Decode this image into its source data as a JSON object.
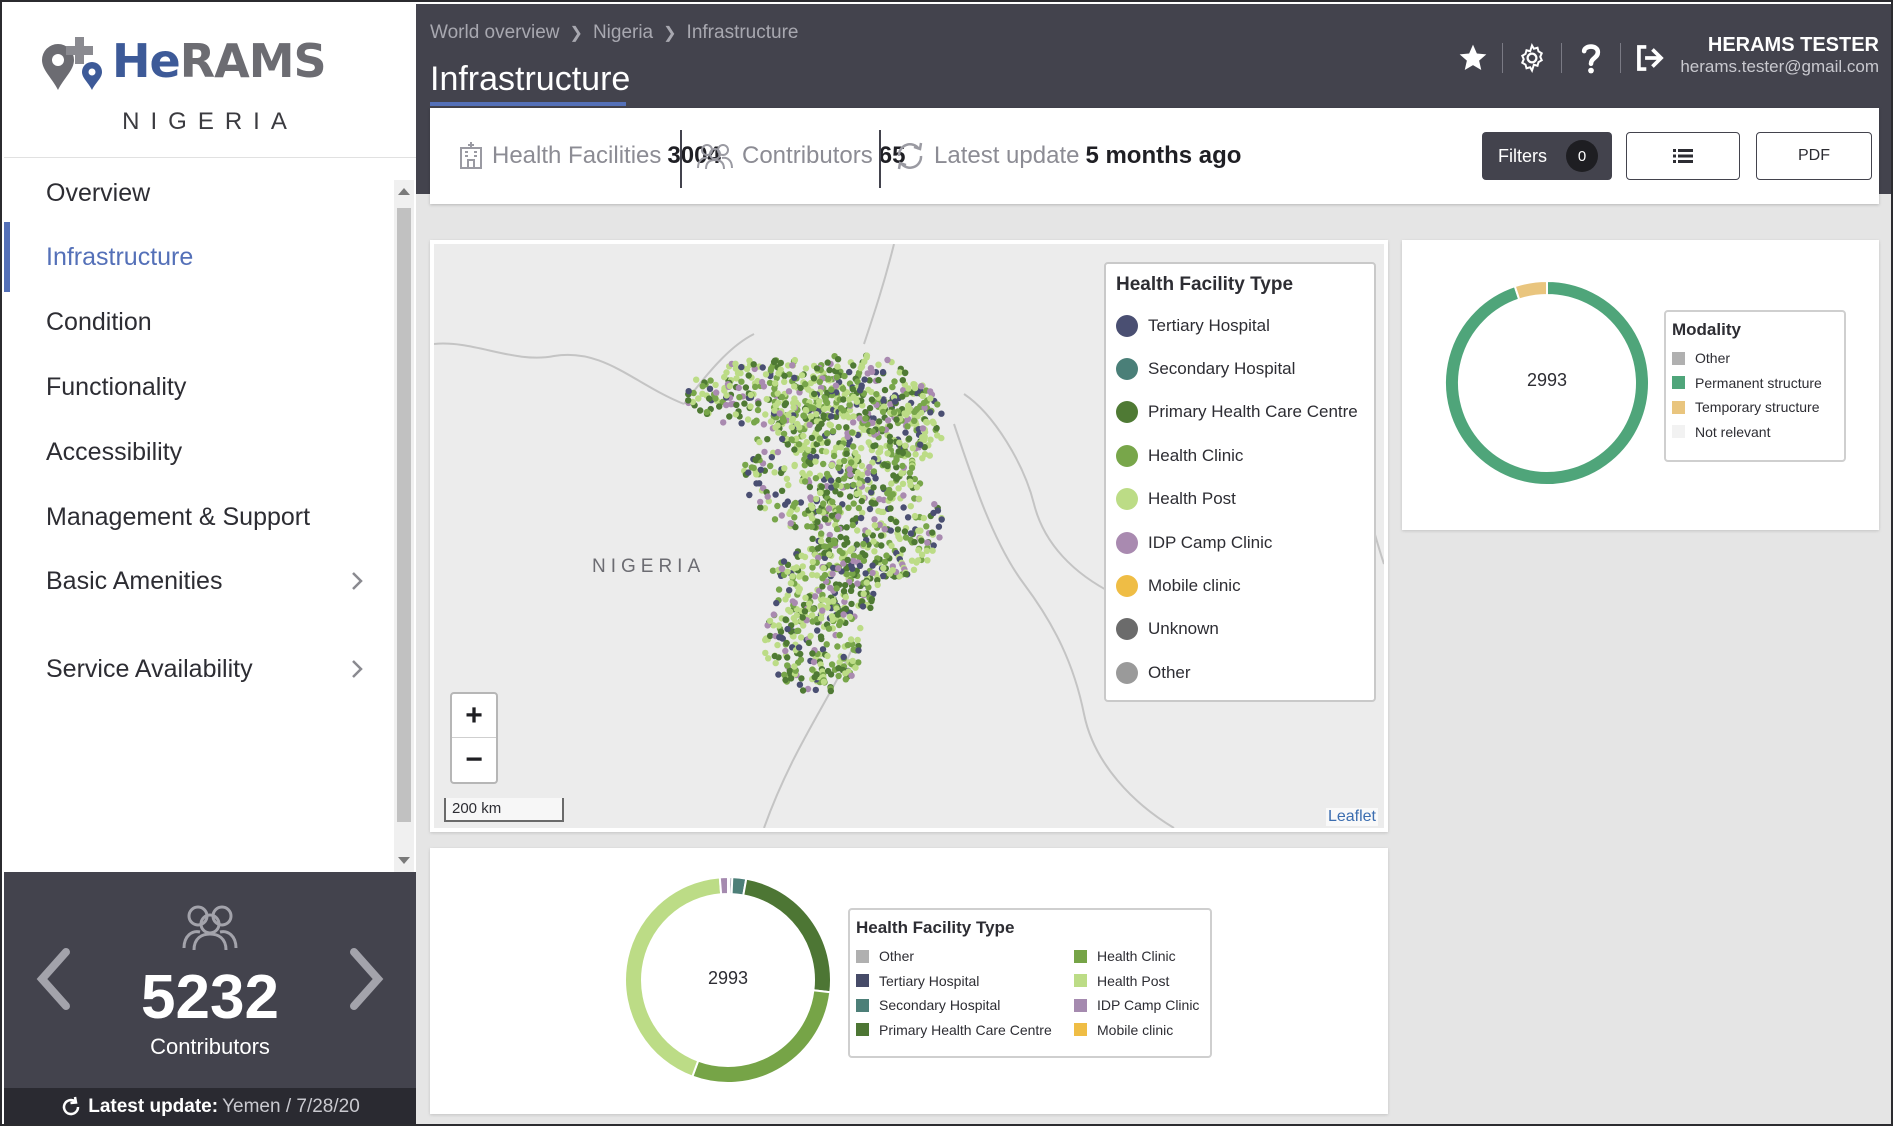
{
  "brand": {
    "logo_he": "He",
    "logo_rams": "RAMS",
    "country": "NIGERIA"
  },
  "sidebar": {
    "items": [
      {
        "label": "Overview",
        "active": false,
        "chevron": false
      },
      {
        "label": "Infrastructure",
        "active": true,
        "chevron": false
      },
      {
        "label": "Condition",
        "active": false,
        "chevron": false
      },
      {
        "label": "Functionality",
        "active": false,
        "chevron": false
      },
      {
        "label": "Accessibility",
        "active": false,
        "chevron": false
      },
      {
        "label": "Management & Support",
        "active": false,
        "chevron": false
      },
      {
        "label": "Basic Amenities",
        "active": false,
        "chevron": true
      },
      {
        "label": "Service Availability",
        "active": false,
        "chevron": true
      }
    ],
    "contributors": {
      "count": "5232",
      "label": "Contributors"
    },
    "latest_update": {
      "label": "Latest update:",
      "value": "Yemen / 7/28/20"
    }
  },
  "header": {
    "breadcrumb": [
      "World overview",
      "Nigeria",
      "Infrastructure"
    ],
    "title": "Infrastructure",
    "user": {
      "name": "HERAMS TESTER",
      "email": "herams.tester@gmail.com"
    },
    "icons": [
      "star-icon",
      "gear-icon",
      "help-icon",
      "logout-icon"
    ]
  },
  "stats": {
    "facilities": {
      "label": "Health Facilities",
      "value": "3004"
    },
    "contributors": {
      "label": "Contributors",
      "value": "65"
    },
    "latest": {
      "label": "Latest update",
      "value": "5 months ago"
    }
  },
  "toolbar": {
    "filters_label": "Filters",
    "filters_count": "0",
    "pdf_label": "PDF"
  },
  "map": {
    "country_label": "NIGERIA",
    "legend_title": "Health Facility Type",
    "legend": [
      {
        "label": "Tertiary Hospital",
        "color": "#4a4f72"
      },
      {
        "label": "Secondary Hospital",
        "color": "#4a7f78"
      },
      {
        "label": "Primary Health Care Centre",
        "color": "#4f7a34"
      },
      {
        "label": "Health Clinic",
        "color": "#78a64a"
      },
      {
        "label": "Health Post",
        "color": "#bcdc86"
      },
      {
        "label": "IDP Camp Clinic",
        "color": "#a98ab0"
      },
      {
        "label": "Mobile clinic",
        "color": "#efbd45"
      },
      {
        "label": "Unknown",
        "color": "#6b6b6b"
      },
      {
        "label": "Other",
        "color": "#9a9a9a"
      }
    ],
    "zoom_in": "+",
    "zoom_out": "−",
    "scale": "200 km",
    "attribution": "Leaflet"
  },
  "modality": {
    "title": "Modality",
    "total": "2993",
    "legend": [
      {
        "label": "Other",
        "color": "#b0b0b0"
      },
      {
        "label": "Permanent structure",
        "color": "#4fa57a"
      },
      {
        "label": "Temporary structure",
        "color": "#e9c57e"
      },
      {
        "label": "Not relevant",
        "color": "#f2f2f2"
      }
    ],
    "chart_data": {
      "type": "pie",
      "categories": [
        "Other",
        "Permanent structure",
        "Temporary structure",
        "Not relevant"
      ],
      "values": [
        0,
        2840,
        153,
        0
      ]
    }
  },
  "facility_types": {
    "title": "Health Facility Type",
    "total": "2993",
    "legend": [
      {
        "label": "Other",
        "color": "#b0b0b0"
      },
      {
        "label": "Tertiary Hospital",
        "color": "#464b68"
      },
      {
        "label": "Secondary Hospital",
        "color": "#4d7f78"
      },
      {
        "label": "Primary Health Care Centre",
        "color": "#4d7634"
      },
      {
        "label": "Health Clinic",
        "color": "#76a447"
      },
      {
        "label": "Health Post",
        "color": "#bcdc86"
      },
      {
        "label": "IDP Camp Clinic",
        "color": "#a58aaf"
      },
      {
        "label": "Mobile clinic",
        "color": "#efbd45"
      }
    ],
    "chart_data": {
      "type": "pie",
      "categories": [
        "Other",
        "Tertiary Hospital",
        "Secondary Hospital",
        "Primary Health Care Centre",
        "Health Clinic",
        "Health Post",
        "IDP Camp Clinic",
        "Mobile clinic"
      ],
      "values": [
        8,
        12,
        65,
        720,
        860,
        1290,
        38,
        0
      ]
    }
  }
}
